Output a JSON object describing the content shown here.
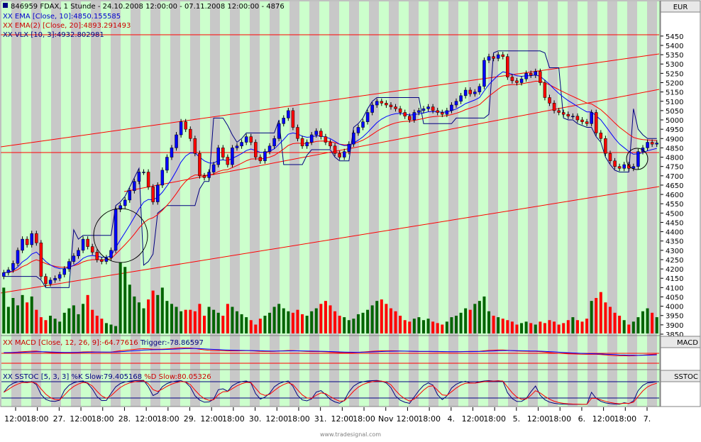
{
  "header": {
    "instrument_line": "846959  FDAX, 1 Stunde - 24.10.2008 12:00:00 - 07.11.2008 12:00:00 - 4876",
    "ema10_label": "XX EMA [Close, 10]:4850.155585",
    "ema20_label": "XX EMA(2) [Close, 20]:4893.291493",
    "vlx_label": "XX VLX [10, 3]:4932.802981"
  },
  "currency_label": "EUR",
  "macd": {
    "label_main": "XX MACD [Close, 12, 26, 9]:-64.77616",
    "label_trigger": " Trigger:-78.86597",
    "panel_name": "MACD"
  },
  "sstoc": {
    "label_k": "XX SSTOC [5, 3, 3] %K Slow:79.405168",
    "label_d": " %D Slow:80.05326",
    "panel_name": "SSTOC"
  },
  "watermark": "www.tradesignal.com",
  "colors": {
    "bull": "#0000ff",
    "bear": "#ff0000",
    "ema10": "#0000ff",
    "ema20": "#ff0000",
    "vlx": "#000080",
    "vol_up": "#006400",
    "vol_down": "#ff0000",
    "band_green": "#ccffcc",
    "band_gray": "#c8c8c8",
    "trendline": "#ff0000"
  },
  "chart_data": {
    "type": "candlestick",
    "y_ticks": [
      3850,
      3900,
      3950,
      4000,
      4050,
      4100,
      4150,
      4200,
      4250,
      4300,
      4350,
      4400,
      4450,
      4500,
      4550,
      4600,
      4650,
      4700,
      4750,
      4800,
      4850,
      4900,
      4950,
      5000,
      5050,
      5100,
      5150,
      5200,
      5250,
      5300,
      5350,
      5400,
      5450
    ],
    "ylim": [
      3825,
      5475
    ],
    "x_tick_labels": [
      "12:00",
      "18:00",
      "27.",
      "12:00",
      "18:00",
      "28.",
      "12:00",
      "18:00",
      "29.",
      "12:00",
      "18:00",
      "30.",
      "12:00",
      "18:00",
      "31.",
      "12:00",
      "18:00",
      "Nov",
      "12:00",
      "18:00",
      "4.",
      "12:00",
      "18:00",
      "5.",
      "12:00",
      "18:00",
      "6.",
      "12:00",
      "18:00",
      "7."
    ],
    "close": [
      4180,
      4195,
      4230,
      4300,
      4360,
      4330,
      4390,
      4340,
      4160,
      4120,
      4140,
      4150,
      4170,
      4200,
      4240,
      4270,
      4300,
      4360,
      4320,
      4290,
      4250,
      4240,
      4260,
      4300,
      4520,
      4540,
      4570,
      4620,
      4670,
      4720,
      4720,
      4640,
      4560,
      4650,
      4730,
      4800,
      4850,
      4920,
      4990,
      4950,
      4900,
      4820,
      4700,
      4690,
      4720,
      4760,
      4850,
      4800,
      4760,
      4850,
      4860,
      4880,
      4910,
      4880,
      4800,
      4780,
      4830,
      4860,
      4900,
      4980,
      5010,
      5050,
      4960,
      4900,
      4860,
      4880,
      4920,
      4940,
      4910,
      4880,
      4860,
      4820,
      4800,
      4830,
      4870,
      4930,
      4960,
      4990,
      5040,
      5080,
      5100,
      5090,
      5080,
      5070,
      5060,
      5040,
      5020,
      5000,
      5040,
      5050,
      5060,
      5070,
      5050,
      5040,
      5030,
      5050,
      5080,
      5100,
      5130,
      5160,
      5140,
      5150,
      5180,
      5320,
      5340,
      5330,
      5350,
      5340,
      5230,
      5210,
      5200,
      5220,
      5250,
      5240,
      5260,
      5200,
      5120,
      5090,
      5050,
      5040,
      5030,
      5020,
      5020,
      5000,
      4990,
      4980,
      5040,
      4930,
      4900,
      4820,
      4780,
      4750,
      4740,
      4760,
      4740,
      4750,
      4830,
      4850,
      4880,
      4870,
      4876
    ],
    "volume": [
      310,
      180,
      240,
      190,
      260,
      210,
      250,
      160,
      110,
      90,
      120,
      100,
      80,
      140,
      170,
      190,
      130,
      200,
      260,
      160,
      120,
      100,
      70,
      60,
      50,
      480,
      450,
      330,
      250,
      210,
      170,
      230,
      290,
      260,
      310,
      220,
      200,
      180,
      150,
      160,
      160,
      150,
      200,
      120,
      180,
      160,
      140,
      120,
      200,
      180,
      150,
      130,
      110,
      90,
      60,
      100,
      120,
      140,
      180,
      200,
      170,
      150,
      140,
      160,
      130,
      120,
      150,
      170,
      200,
      220,
      190,
      150,
      120,
      110,
      90,
      100,
      130,
      140,
      160,
      190,
      220,
      230,
      200,
      170,
      150,
      120,
      90,
      80,
      100,
      110,
      90,
      100,
      80,
      70,
      60,
      80,
      110,
      120,
      140,
      170,
      160,
      200,
      220,
      250,
      150,
      120,
      110,
      100,
      90,
      80,
      60,
      70,
      80,
      70,
      60,
      80,
      70,
      90,
      80,
      60,
      70,
      90,
      110,
      90,
      80,
      100,
      220,
      240,
      280,
      210,
      180,
      140,
      120,
      90,
      60,
      80,
      110,
      150,
      170,
      140,
      110
    ]
  }
}
